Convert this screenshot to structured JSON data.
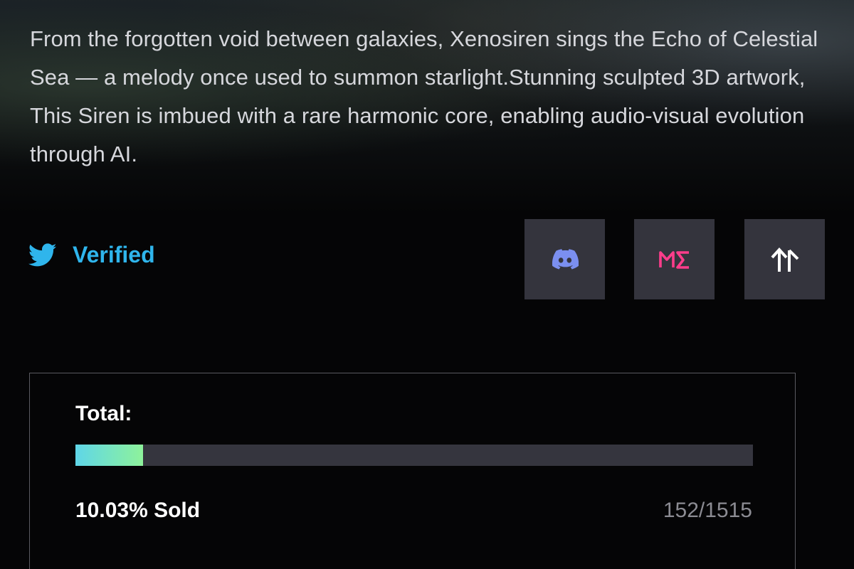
{
  "description": "From the forgotten void between galaxies, Xenosiren sings the Echo of Celestial Sea — a melody once used to summon starlight.Stunning sculpted 3D artwork, This Siren is imbued with a rare harmonic core, enabling audio-visual evolution through AI.",
  "social": {
    "verified_label": "Verified",
    "twitter_icon": "twitter-bird-icon",
    "buttons": [
      {
        "name": "discord",
        "icon": "discord-icon",
        "color": "#7b8ff0"
      },
      {
        "name": "magic-eden",
        "icon": "magic-eden-icon",
        "glyph": "ME",
        "color": "#ff3d8b"
      },
      {
        "name": "marketplace-arrows",
        "icon": "up-arrows-icon",
        "color": "#ffffff"
      }
    ]
  },
  "total": {
    "label": "Total:",
    "sold_label": "10.03% Sold",
    "sold_fraction": 0.1003,
    "count": "152/1515",
    "fill_gradient": [
      "#5fd6e8",
      "#8ef29b"
    ],
    "track_color": "#35353e"
  },
  "colors": {
    "background": "#050506",
    "accent": "#2fb5ec",
    "button_bg": "#34343d"
  }
}
